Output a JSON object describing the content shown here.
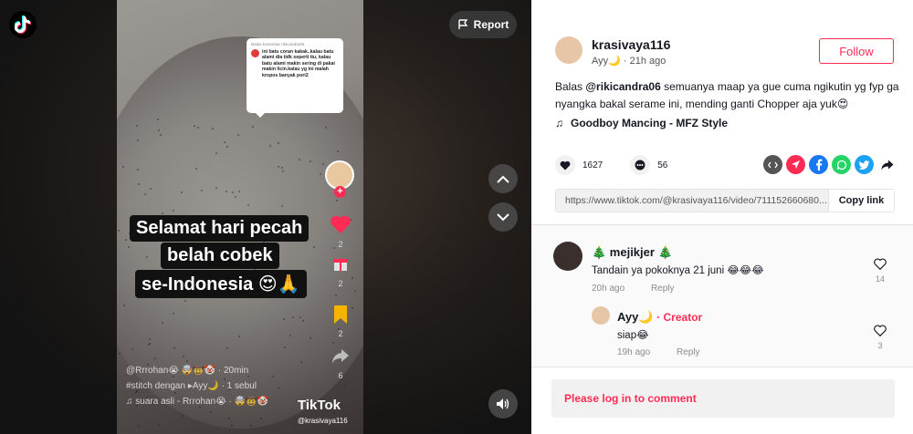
{
  "video": {
    "report_label": "Report",
    "comment_card": {
      "reply_header": "Balas komentar rikicandra06",
      "text": "ini batu coran kakak..kalau batu alami dia tidk seperti itu, kalau batu alami makin sering di pakai makin licin.kalau yg ini malah kropos banyak pori2"
    },
    "captions": [
      "Selamat hari pecah",
      "belah cobek",
      "se-Indonesia 😍🙏"
    ],
    "rail_counts": {
      "like": "2",
      "comment": "2",
      "bookmark": "2",
      "share": "6"
    },
    "meta_lines": [
      "@Rrrohan😭 🤯🤠🤡 · 20min",
      "#stitch dengan ▸Ayy🌙 · 1 sebul",
      "♫  suara asli - Rrrohan😭 · 🤯🤠🤡"
    ],
    "watermark": "TikTok",
    "watermark_handle": "@krasivaya116"
  },
  "post": {
    "author": "krasivaya116",
    "author_sub": "Ayy🌙 · 21h ago",
    "follow_label": "Follow",
    "desc_prefix": "Balas ",
    "desc_mention": "@rikicandra06",
    "desc_rest": " semuanya maap ya gue cuma ngikutin yg fyp ga nyangka bakal serame ini, mending ganti Chopper aja yuk😍",
    "music": "Goodboy Mancing - MFZ Style",
    "likes": "1627",
    "comments": "56",
    "link": "https://www.tiktok.com/@krasivaya116/video/711152660680...",
    "copy_label": "Copy link"
  },
  "comments": [
    {
      "name": "🎄 mejikjer 🎄",
      "text": "Tandain ya pokoknya 21 juni 😂😂😂",
      "time": "20h ago",
      "reply": "Reply",
      "likes": "14"
    },
    {
      "name": "Ayy🌙",
      "creator": "· Creator",
      "text": "siap😂",
      "time": "19h ago",
      "reply": "Reply",
      "likes": "3"
    }
  ],
  "login_prompt": "Please log in to comment",
  "colors": {
    "accent": "#fe2c55",
    "panel_bg": "#ffffff",
    "video_bg": "#141414"
  }
}
